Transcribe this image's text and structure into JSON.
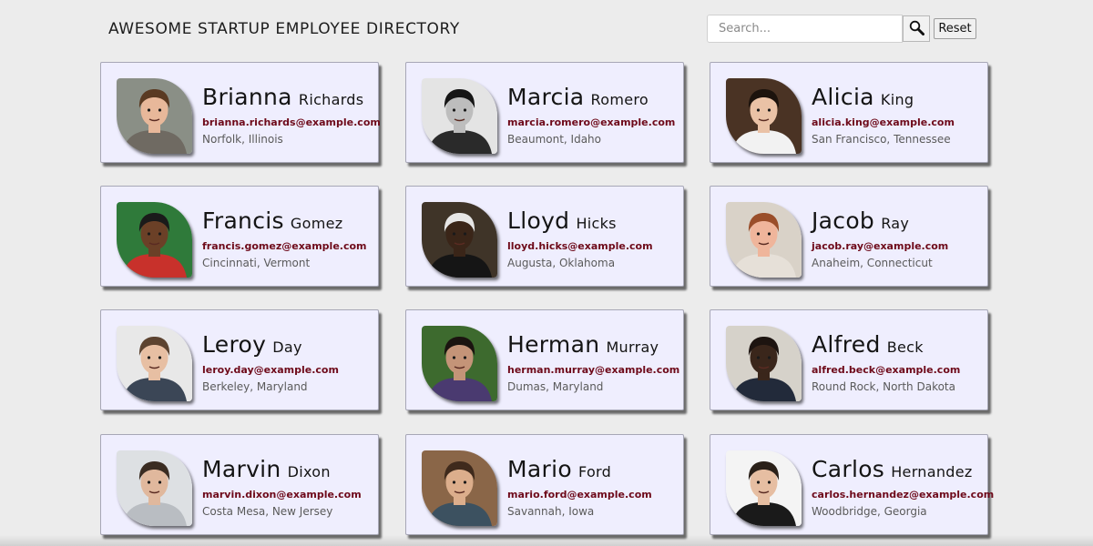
{
  "header": {
    "title": "AWESOME STARTUP EMPLOYEE DIRECTORY",
    "search_placeholder": "Search...",
    "search_value": "",
    "search_icon": "magnifier-icon",
    "reset_label": "Reset"
  },
  "colors": {
    "page_bg": "#ececec",
    "card_bg": "#efeefe",
    "email": "#6e0a1a",
    "location": "#5a5a5a"
  },
  "employees": [
    {
      "first": "Brianna",
      "last": "Richards",
      "email": "brianna.richards@example.com",
      "location": "Norfolk, Illinois",
      "photo": {
        "bg": "#8a8f86",
        "skin": "#e8b89a",
        "hair": "#5a3a22",
        "shirt": "#6f6a62"
      }
    },
    {
      "first": "Marcia",
      "last": "Romero",
      "email": "marcia.romero@example.com",
      "location": "Beaumont, Idaho",
      "photo": {
        "bg": "#e4e4e4",
        "skin": "#bdbdbd",
        "hair": "#161616",
        "shirt": "#2a2a2a"
      }
    },
    {
      "first": "Alicia",
      "last": "King",
      "email": "alicia.king@example.com",
      "location": "San Francisco, Tennessee",
      "photo": {
        "bg": "#4a3324",
        "skin": "#eac2a6",
        "hair": "#1c130d",
        "shirt": "#f2f2f2"
      }
    },
    {
      "first": "Francis",
      "last": "Gomez",
      "email": "francis.gomez@example.com",
      "location": "Cincinnati, Vermont",
      "photo": {
        "bg": "#2f7a3a",
        "skin": "#6b4027",
        "hair": "#1a1a1a",
        "shirt": "#c8312b"
      }
    },
    {
      "first": "Lloyd",
      "last": "Hicks",
      "email": "lloyd.hicks@example.com",
      "location": "Augusta, Oklahoma",
      "photo": {
        "bg": "#3f3428",
        "skin": "#3a2518",
        "hair": "#e6e6e6",
        "shirt": "#151515"
      }
    },
    {
      "first": "Jacob",
      "last": "Ray",
      "email": "jacob.ray@example.com",
      "location": "Anaheim, Connecticut",
      "photo": {
        "bg": "#d9d2c8",
        "skin": "#efb59b",
        "hair": "#9a4e2a",
        "shirt": "#e6e0d8"
      }
    },
    {
      "first": "Leroy",
      "last": "Day",
      "email": "leroy.day@example.com",
      "location": "Berkeley, Maryland",
      "photo": {
        "bg": "#e8e8e8",
        "skin": "#e7bfa3",
        "hair": "#5c4330",
        "shirt": "#3b4656"
      }
    },
    {
      "first": "Herman",
      "last": "Murray",
      "email": "herman.murray@example.com",
      "location": "Dumas, Maryland",
      "photo": {
        "bg": "#3d6a2e",
        "skin": "#c49478",
        "hair": "#1b1410",
        "shirt": "#4a3a70"
      }
    },
    {
      "first": "Alfred",
      "last": "Beck",
      "email": "alfred.beck@example.com",
      "location": "Round Rock, North Dakota",
      "photo": {
        "bg": "#d6d2ca",
        "skin": "#3a261b",
        "hair": "#1d1410",
        "shirt": "#222a3a"
      }
    },
    {
      "first": "Marvin",
      "last": "Dixon",
      "email": "marvin.dixon@example.com",
      "location": "Costa Mesa, New Jersey",
      "photo": {
        "bg": "#dde0e3",
        "skin": "#e0b89d",
        "hair": "#3a2c22",
        "shirt": "#b9bdc2"
      }
    },
    {
      "first": "Mario",
      "last": "Ford",
      "email": "mario.ford@example.com",
      "location": "Savannah, Iowa",
      "photo": {
        "bg": "#8a6648",
        "skin": "#dcae8c",
        "hair": "#3f2a1c",
        "shirt": "#3c5160"
      }
    },
    {
      "first": "Carlos",
      "last": "Hernandez",
      "email": "carlos.hernandez@example.com",
      "location": "Woodbridge, Georgia",
      "photo": {
        "bg": "#f4f4f4",
        "skin": "#e6bea2",
        "hair": "#2a2019",
        "shirt": "#1a1a1a"
      }
    }
  ]
}
